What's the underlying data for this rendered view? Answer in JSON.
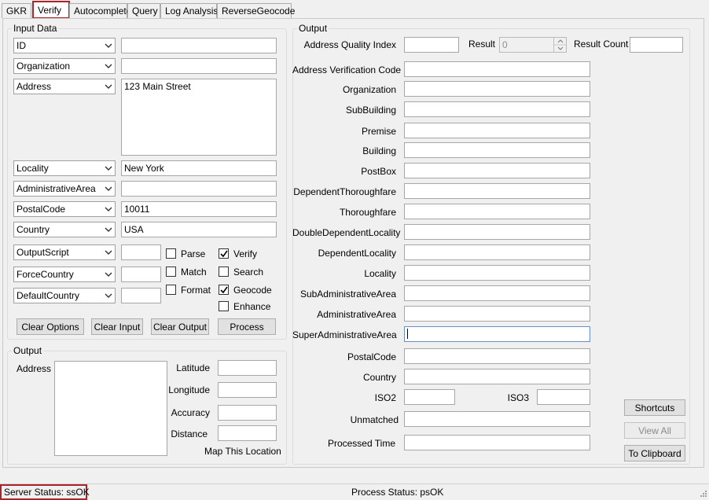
{
  "tabs": [
    "GKR",
    "Verify",
    "Autocomplete",
    "Query",
    "Log Analysis",
    "ReverseGeocode"
  ],
  "active_tab": "Verify",
  "input_data": {
    "title": "Input Data",
    "rows": [
      {
        "combo": "ID",
        "value": ""
      },
      {
        "combo": "Organization",
        "value": ""
      },
      {
        "combo": "Address",
        "value": "123 Main Street"
      },
      {
        "combo": "Locality",
        "value": "New York"
      },
      {
        "combo": "AdministrativeArea",
        "value": ""
      },
      {
        "combo": "PostalCode",
        "value": "10011"
      },
      {
        "combo": "Country",
        "value": "USA"
      }
    ],
    "option_rows": [
      {
        "combo": "OutputScript",
        "value": ""
      },
      {
        "combo": "ForceCountry",
        "value": ""
      },
      {
        "combo": "DefaultCountry",
        "value": ""
      }
    ],
    "checkboxes": {
      "parse": {
        "label": "Parse",
        "checked": false
      },
      "match": {
        "label": "Match",
        "checked": false
      },
      "format": {
        "label": "Format",
        "checked": false
      },
      "verify": {
        "label": "Verify",
        "checked": true
      },
      "search": {
        "label": "Search",
        "checked": false
      },
      "geocode": {
        "label": "Geocode",
        "checked": true
      },
      "enhance": {
        "label": "Enhance",
        "checked": false
      }
    },
    "buttons": {
      "clear_options": "Clear Options",
      "clear_input": "Clear Input",
      "clear_output": "Clear Output",
      "process": "Process"
    }
  },
  "geo_output": {
    "title": "Output",
    "address_label": "Address",
    "latitude": "Latitude",
    "longitude": "Longitude",
    "accuracy": "Accuracy",
    "distance": "Distance",
    "map_link": "Map This Location"
  },
  "output": {
    "title": "Output",
    "aqi_label": "Address Quality Index",
    "result_label": "Result",
    "result_value": "0",
    "result_count_label": "Result Count",
    "fields": [
      "Address Verification Code",
      "Organization",
      "SubBuilding",
      "Premise",
      "Building",
      "PostBox",
      "DependentThoroughfare",
      "Thoroughfare",
      "DoubleDependentLocality",
      "DependentLocality",
      "Locality",
      "SubAdministrativeArea",
      "AdministrativeArea",
      "SuperAdministrativeArea",
      "PostalCode",
      "Country"
    ],
    "iso2_label": "ISO2",
    "iso3_label": "ISO3",
    "unmatched_label": "Unmatched",
    "processed_time_label": "Processed Time",
    "shortcuts_button": "Shortcuts",
    "view_all_button": "View All",
    "clipboard_button": "To Clipboard"
  },
  "status": {
    "server": "Server Status: ssOK",
    "process": "Process Status: psOK"
  },
  "colors": {
    "highlight": "#a8262a",
    "focus_border": "#6a8fc5"
  }
}
